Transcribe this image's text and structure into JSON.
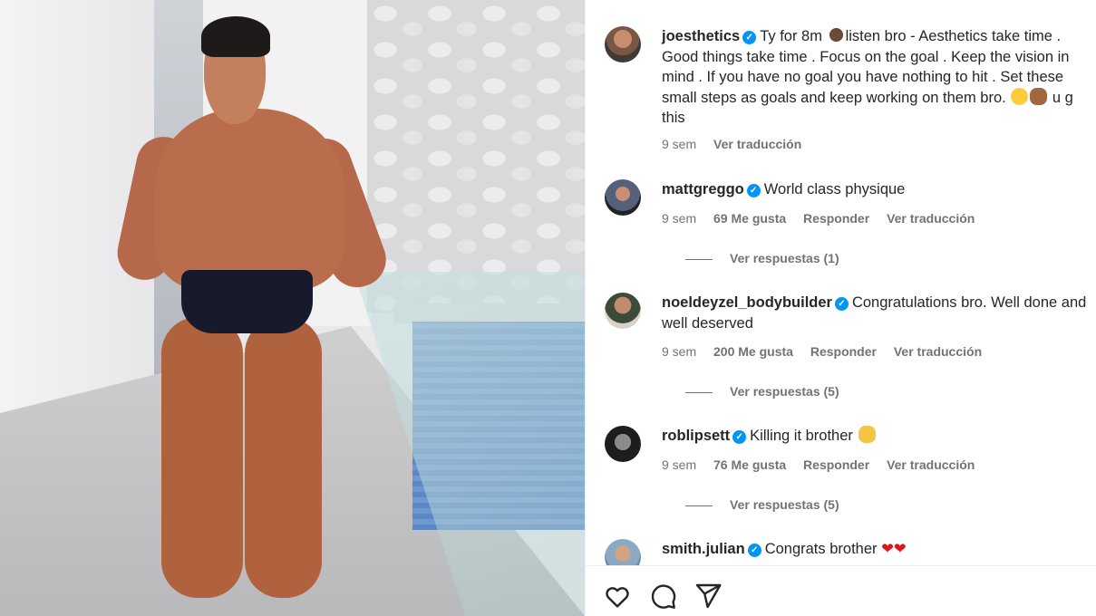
{
  "post": {
    "author": "joesthetics",
    "caption_lines": [
      "Ty for 8m",
      "listen bro - Aesthetics take time .",
      "Good things take time . Focus on the goal . Keep the vision in",
      "mind . If you have no goal you have nothing to hit . Set these",
      "small steps as goals and keep working on them bro.",
      "u g",
      "this"
    ],
    "time": "9 sem",
    "translate": "Ver traducción"
  },
  "comments": [
    {
      "username": "mattgreggo",
      "lines": [
        "World class physique"
      ],
      "time": "9 sem",
      "likes": "69 Me gusta",
      "reply": "Responder",
      "translate": "Ver traducción",
      "view_replies": "Ver respuestas (1)"
    },
    {
      "username": "noeldeyzel_bodybuilder",
      "lines": [
        "Congratulations bro. Well done and",
        "well deserved"
      ],
      "time": "9 sem",
      "likes": "200 Me gusta",
      "reply": "Responder",
      "translate": "Ver traducción",
      "view_replies": "Ver respuestas (5)"
    },
    {
      "username": "roblipsett",
      "lines": [
        "Killing it brother"
      ],
      "time": "9 sem",
      "likes": "76 Me gusta",
      "reply": "Responder",
      "translate": "Ver traducción",
      "view_replies": "Ver respuestas (5)"
    },
    {
      "username": "smith.julian",
      "lines": [
        "Congrats brother"
      ]
    }
  ],
  "icons": {
    "like": "heart-icon",
    "comment": "comment-icon",
    "share": "share-icon",
    "verified": "verified-badge-icon"
  },
  "colors": {
    "verified": "#0095f6",
    "text": "#262626",
    "muted": "#737373",
    "heart_emoji": "#e0161d"
  }
}
